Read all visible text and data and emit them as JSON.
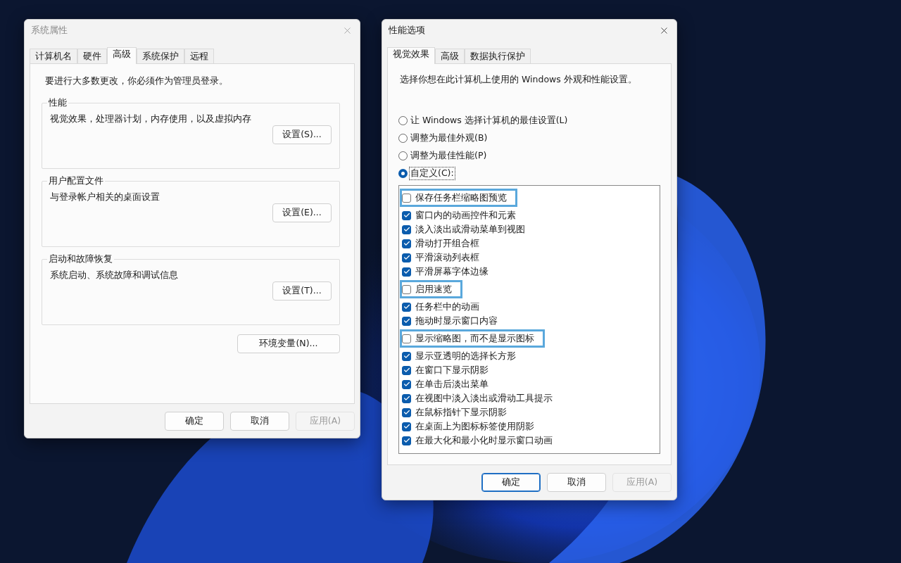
{
  "system_properties": {
    "title": "系统属性",
    "tabs": [
      {
        "label": "计算机名",
        "selected": false
      },
      {
        "label": "硬件",
        "selected": false
      },
      {
        "label": "高级",
        "selected": true
      },
      {
        "label": "系统保护",
        "selected": false
      },
      {
        "label": "远程",
        "selected": false
      }
    ],
    "notice": "要进行大多数更改，你必须作为管理员登录。",
    "groups": [
      {
        "title": "性能",
        "description": "视觉效果，处理器计划，内存使用，以及虚拟内存",
        "button": "设置(S)..."
      },
      {
        "title": "用户配置文件",
        "description": "与登录帐户相关的桌面设置",
        "button": "设置(E)..."
      },
      {
        "title": "启动和故障恢复",
        "description": "系统启动、系统故障和调试信息",
        "button": "设置(T)..."
      }
    ],
    "env_button": "环境变量(N)...",
    "buttons": [
      {
        "label": "确定",
        "default": false,
        "disabled": false
      },
      {
        "label": "取消",
        "default": false,
        "disabled": false
      },
      {
        "label": "应用(A)",
        "default": false,
        "disabled": true
      }
    ]
  },
  "performance_options": {
    "title": "性能选项",
    "tabs": [
      {
        "label": "视觉效果",
        "selected": true
      },
      {
        "label": "高级",
        "selected": false
      },
      {
        "label": "数据执行保护",
        "selected": false
      }
    ],
    "intro": "选择你想在此计算机上使用的 Windows 外观和性能设置。",
    "radios": [
      {
        "label": "让 Windows 选择计算机的最佳设置(L)",
        "selected": false
      },
      {
        "label": "调整为最佳外观(B)",
        "selected": false
      },
      {
        "label": "调整为最佳性能(P)",
        "selected": false
      },
      {
        "label": "自定义(C):",
        "selected": true
      }
    ],
    "options": [
      {
        "label": "保存任务栏缩略图预览",
        "checked": false,
        "highlighted": true
      },
      {
        "label": "窗口内的动画控件和元素",
        "checked": true,
        "highlighted": false
      },
      {
        "label": "淡入淡出或滑动菜单到视图",
        "checked": true,
        "highlighted": false
      },
      {
        "label": "滑动打开组合框",
        "checked": true,
        "highlighted": false
      },
      {
        "label": "平滑滚动列表框",
        "checked": true,
        "highlighted": false
      },
      {
        "label": "平滑屏幕字体边缘",
        "checked": true,
        "highlighted": false
      },
      {
        "label": "启用速览",
        "checked": false,
        "highlighted": true
      },
      {
        "label": "任务栏中的动画",
        "checked": true,
        "highlighted": false
      },
      {
        "label": "拖动时显示窗口内容",
        "checked": true,
        "highlighted": false
      },
      {
        "label": "显示缩略图，而不是显示图标",
        "checked": false,
        "highlighted": true
      },
      {
        "label": "显示亚透明的选择长方形",
        "checked": true,
        "highlighted": false
      },
      {
        "label": "在窗口下显示阴影",
        "checked": true,
        "highlighted": false
      },
      {
        "label": "在单击后淡出菜单",
        "checked": true,
        "highlighted": false
      },
      {
        "label": "在视图中淡入淡出或滑动工具提示",
        "checked": true,
        "highlighted": false
      },
      {
        "label": "在鼠标指针下显示阴影",
        "checked": true,
        "highlighted": false
      },
      {
        "label": "在桌面上为图标标签使用阴影",
        "checked": true,
        "highlighted": false
      },
      {
        "label": "在最大化和最小化时显示窗口动画",
        "checked": true,
        "highlighted": false
      }
    ],
    "buttons": [
      {
        "label": "确定",
        "default": true,
        "disabled": false
      },
      {
        "label": "取消",
        "default": false,
        "disabled": false
      },
      {
        "label": "应用(A)",
        "default": false,
        "disabled": true
      }
    ]
  }
}
